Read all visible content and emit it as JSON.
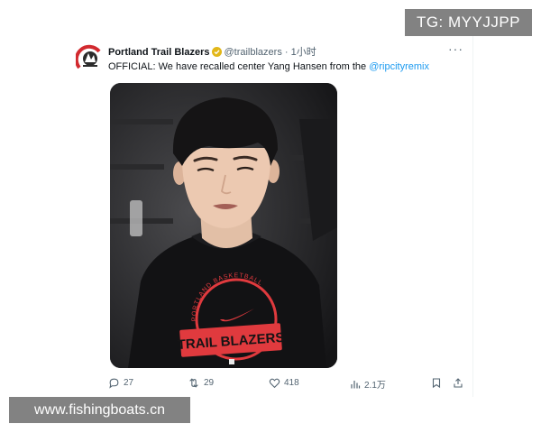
{
  "post": {
    "author_name": "Portland Trail Blazers",
    "author_handle": "@trailblazers",
    "separator": "·",
    "time": "1小时",
    "text_prefix": "OFFICIAL: We have recalled center Yang Hansen from the ",
    "mention": "@ripcityremix",
    "shirt_text": "TRAIL BLAZERS",
    "shirt_arc_text": "PORTLAND BASKETBALL"
  },
  "actions": {
    "replies": "27",
    "reposts": "29",
    "likes": "418",
    "views": "2.1万"
  },
  "watermarks": {
    "top": "TG: MYYJJPP",
    "bottom": "www.fishingboats.cn"
  },
  "colors": {
    "accent_link": "#1d9bf0",
    "verified_gold": "#e2b719",
    "shirt_red": "#e03a3e",
    "text_secondary": "#536471"
  },
  "icons": [
    "team-logo-icon",
    "verified-badge-icon",
    "more-options-icon",
    "reply-icon",
    "repost-icon",
    "like-icon",
    "views-icon",
    "bookmark-icon",
    "share-icon"
  ]
}
